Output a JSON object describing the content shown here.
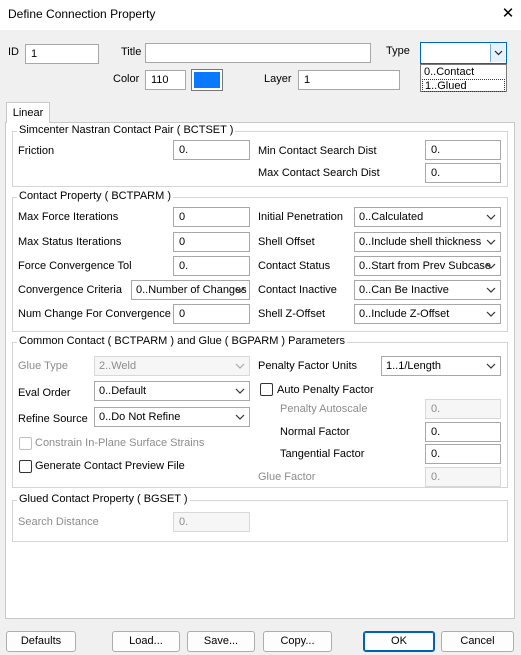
{
  "window": {
    "title": "Define Connection Property"
  },
  "header": {
    "id_label": "ID",
    "id_value": "1",
    "title_label": "Title",
    "title_value": "",
    "type_label": "Type",
    "type_value": "",
    "type_options": [
      "0..Contact",
      "1..Glued"
    ],
    "color_label": "Color",
    "color_value": "110",
    "color_swatch": "#0a78ff",
    "layer_label": "Layer",
    "layer_value": "1"
  },
  "tabs": [
    {
      "label": "Linear"
    }
  ],
  "bctset": {
    "title": "Simcenter Nastran Contact Pair ( BCTSET )",
    "friction_label": "Friction",
    "friction_value": "0.",
    "min_dist_label": "Min Contact Search Dist",
    "min_dist_value": "0.",
    "max_dist_label": "Max Contact Search Dist",
    "max_dist_value": "0."
  },
  "bctparm": {
    "title": "Contact Property ( BCTPARM )",
    "max_force_iter_label": "Max Force Iterations",
    "max_force_iter_value": "0",
    "max_status_iter_label": "Max Status Iterations",
    "max_status_iter_value": "0",
    "force_conv_tol_label": "Force Convergence Tol",
    "force_conv_tol_value": "0.",
    "conv_criteria_label": "Convergence Criteria",
    "conv_criteria_value": "0..Number of Changes",
    "num_change_label": "Num Change For Convergence",
    "num_change_value": "0",
    "initial_pen_label": "Initial Penetration",
    "initial_pen_value": "0..Calculated",
    "shell_offset_label": "Shell Offset",
    "shell_offset_value": "0..Include shell thickness",
    "contact_status_label": "Contact Status",
    "contact_status_value": "0..Start from Prev Subcase",
    "contact_inactive_label": "Contact Inactive",
    "contact_inactive_value": "0..Can Be Inactive",
    "shell_z_label": "Shell Z-Offset",
    "shell_z_value": "0..Include Z-Offset"
  },
  "common": {
    "title": "Common Contact ( BCTPARM ) and Glue ( BGPARM ) Parameters",
    "glue_type_label": "Glue Type",
    "glue_type_value": "2..Weld",
    "eval_order_label": "Eval Order",
    "eval_order_value": "0..Default",
    "refine_source_label": "Refine Source",
    "refine_source_value": "0..Do Not Refine",
    "constrain_label": "Constrain In-Plane Surface Strains",
    "preview_label": "Generate Contact Preview File",
    "penalty_units_label": "Penalty Factor Units",
    "penalty_units_value": "1..1/Length",
    "auto_penalty_label": "Auto Penalty Factor",
    "penalty_autoscale_label": "Penalty Autoscale",
    "penalty_autoscale_value": "0.",
    "normal_factor_label": "Normal Factor",
    "normal_factor_value": "0.",
    "tangential_factor_label": "Tangential Factor",
    "tangential_factor_value": "0.",
    "glue_factor_label": "Glue Factor",
    "glue_factor_value": "0."
  },
  "bgset": {
    "title": "Glued Contact Property ( BGSET )",
    "search_distance_label": "Search Distance",
    "search_distance_value": "0."
  },
  "buttons": {
    "defaults": "Defaults",
    "load": "Load...",
    "save": "Save...",
    "copy": "Copy...",
    "ok": "OK",
    "cancel": "Cancel"
  }
}
